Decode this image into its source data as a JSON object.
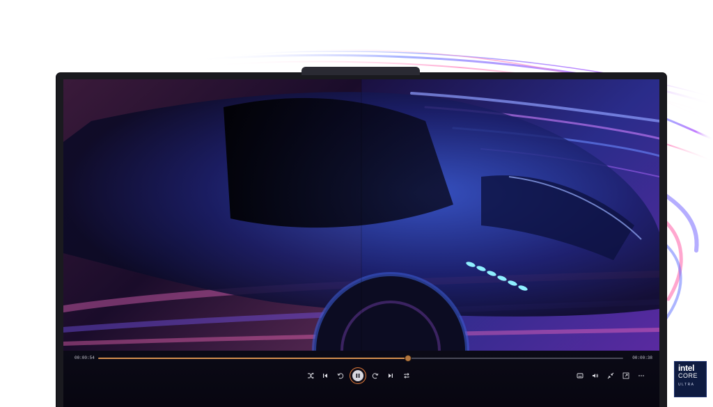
{
  "player": {
    "current_time": "00:00:54",
    "duration": "00:00:38",
    "progress": 0.59,
    "accent_color": "#d6914f"
  },
  "controls": {
    "left_group": [
      "shuffle-icon",
      "previous-icon",
      "rewind-10-icon",
      "pause-icon",
      "forward-30-icon",
      "next-icon",
      "repeat-icon"
    ],
    "right_group": [
      "subtitles-icon",
      "volume-icon",
      "minimize-icon",
      "fullscreen-icon",
      "more-icon"
    ]
  },
  "badge": {
    "brand": "intel",
    "line": "CORE",
    "sub": "ULTRA",
    "background": "#0e1b40"
  }
}
